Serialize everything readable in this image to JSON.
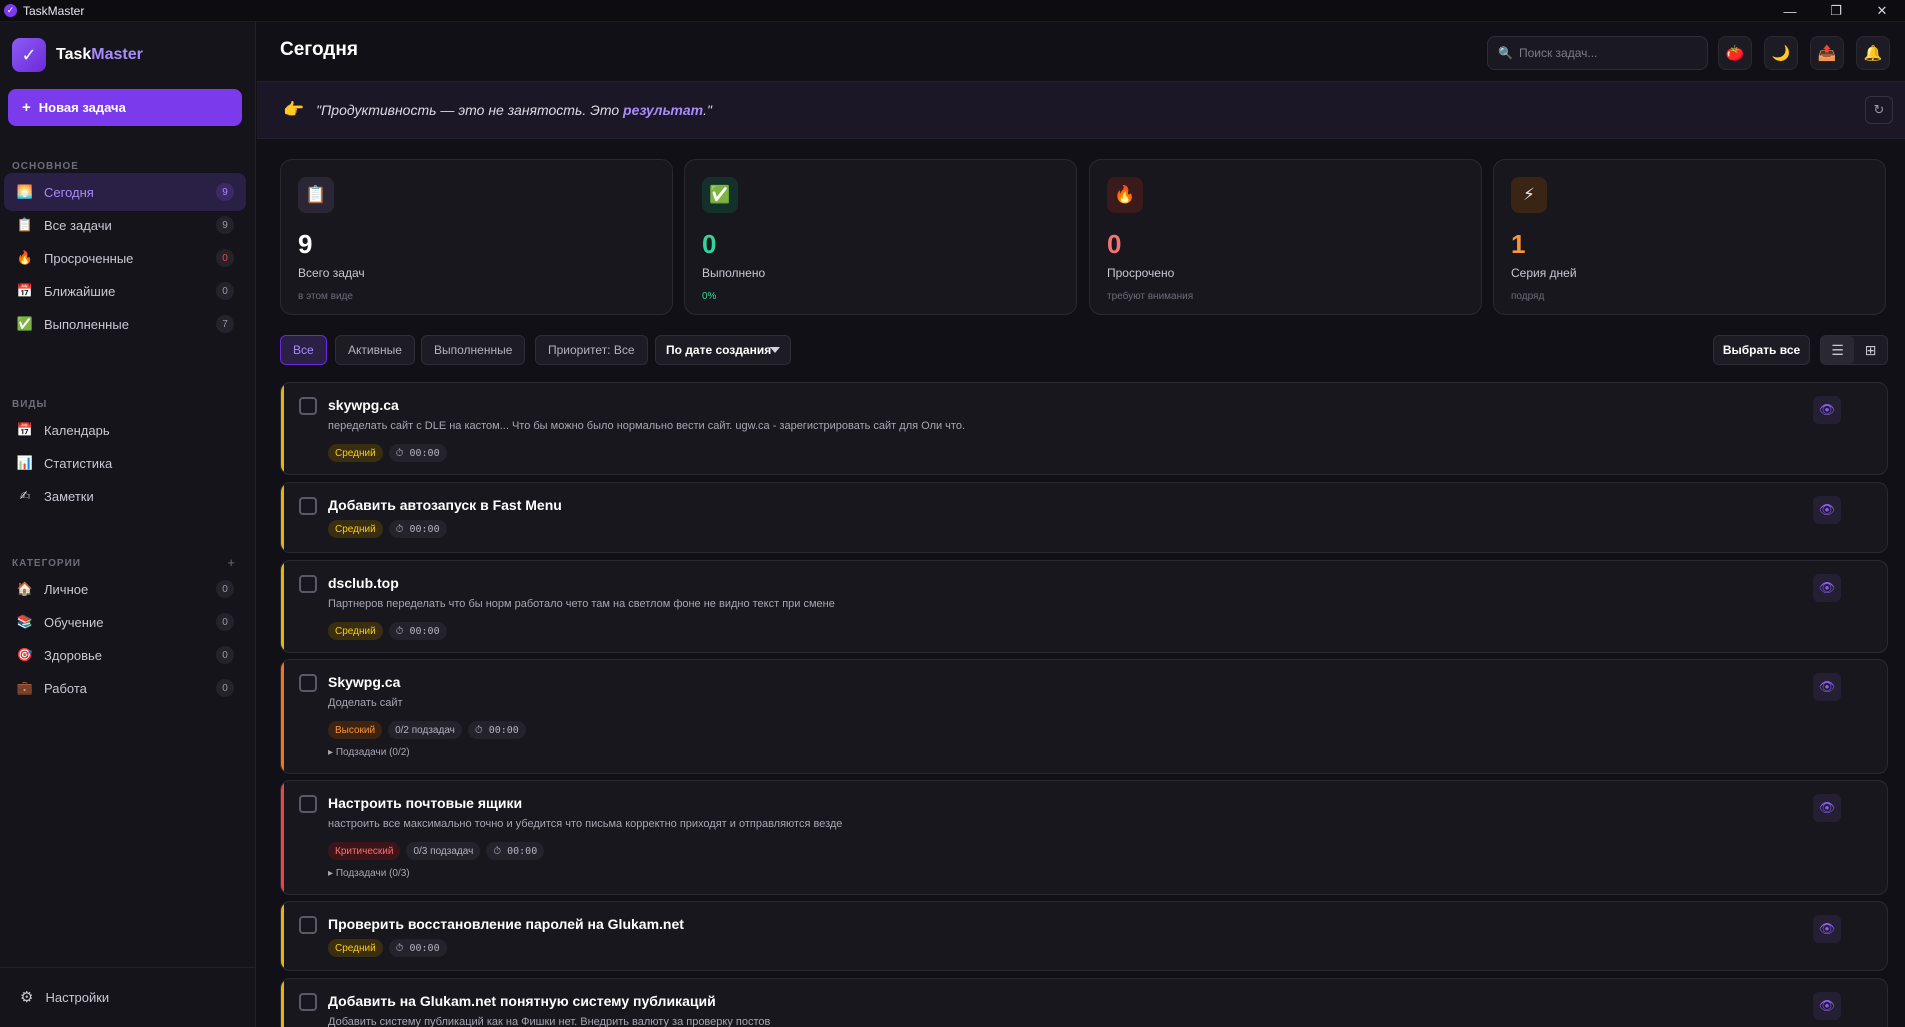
{
  "window": {
    "title": "TaskMaster",
    "minimize": "—",
    "maximize": "❐",
    "close": "✕"
  },
  "sidebar": {
    "brand_prefix": "Task",
    "brand_suffix": "Master",
    "new_task_label": "Новая задача",
    "section_main": "ОСНОВНОЕ",
    "section_views": "ВИДЫ",
    "section_categories": "КАТЕГОРИИ",
    "main_items": [
      {
        "label": "Сегодня",
        "count": "9",
        "icon": "sunrise-icon",
        "glyph": "🌅"
      },
      {
        "label": "Все задачи",
        "count": "9",
        "icon": "clipboard-icon",
        "glyph": "📋"
      },
      {
        "label": "Просроченные",
        "count": "0",
        "icon": "fire-icon",
        "glyph": "🔥"
      },
      {
        "label": "Ближайшие",
        "count": "0",
        "icon": "calendar-icon",
        "glyph": "📅"
      },
      {
        "label": "Выполненные",
        "count": "7",
        "icon": "check-box-icon",
        "glyph": "✅"
      }
    ],
    "view_items": [
      {
        "label": "Календарь",
        "icon": "calendar-icon",
        "glyph": "📅"
      },
      {
        "label": "Статистика",
        "icon": "bar-chart-icon",
        "glyph": "📊"
      },
      {
        "label": "Заметки",
        "icon": "writing-hand-icon",
        "glyph": "✍"
      }
    ],
    "category_items": [
      {
        "label": "Личное",
        "count": "0",
        "icon": "house-icon",
        "glyph": "🏠"
      },
      {
        "label": "Обучение",
        "count": "0",
        "icon": "books-icon",
        "glyph": "📚"
      },
      {
        "label": "Здоровье",
        "count": "0",
        "icon": "target-icon",
        "glyph": "🎯"
      },
      {
        "label": "Работа",
        "count": "0",
        "icon": "briefcase-icon",
        "glyph": "💼"
      }
    ],
    "settings_label": "Настройки"
  },
  "header": {
    "title": "Сегодня",
    "search_placeholder": "Поиск задач..."
  },
  "quote": {
    "before": "\"Продуктивность — это не занятость. Это ",
    "highlight": "результат",
    "after": ".\""
  },
  "stats": [
    {
      "value": "9",
      "label": "Всего задач",
      "sub": "в этом виде",
      "icon": "clipboard-icon",
      "glyph": "📋",
      "color": "#ffffff",
      "bg": "#2a2635",
      "sub_color": "#6e6c78"
    },
    {
      "value": "0",
      "label": "Выполнено",
      "sub": "0%",
      "icon": "check-box-icon",
      "glyph": "✅",
      "color": "#34d399",
      "bg": "#14302a",
      "sub_color": "#34d399"
    },
    {
      "value": "0",
      "label": "Просрочено",
      "sub": "требуют внимания",
      "icon": "fire-icon",
      "glyph": "🔥",
      "color": "#f87171",
      "bg": "#3a1a1a",
      "sub_color": "#6e6c78"
    },
    {
      "value": "1",
      "label": "Серия дней",
      "sub": "подряд",
      "icon": "lightning-icon",
      "glyph": "⚡",
      "color": "#fb923c",
      "bg": "#3a2414",
      "sub_color": "#6e6c78"
    }
  ],
  "filters": {
    "all": "Все",
    "active": "Активные",
    "done": "Выполненные",
    "priority": "Приоритет: Все",
    "sort": "По дате создания",
    "select_all": "Выбрать все"
  },
  "tasks": [
    {
      "title": "skywpg.ca",
      "desc": "переделать сайт с DLE на кастом... Что бы можно было нормально вести сайт. ugw.ca - зарегистрировать сайт для Оли что.",
      "priority": "Средний",
      "priority_class": "med",
      "subtasks_badge": "",
      "timer": "00:00",
      "subtasks_toggle": "",
      "accent": "#eab308"
    },
    {
      "title": "Добавить автозапуск в Fast Menu",
      "desc": "",
      "priority": "Средний",
      "priority_class": "med",
      "subtasks_badge": "",
      "timer": "00:00",
      "subtasks_toggle": "",
      "accent": "#eab308"
    },
    {
      "title": "dsclub.top",
      "desc": "Партнеров переделать что бы норм работало чето там на светлом фоне не видно текст при смене",
      "priority": "Средний",
      "priority_class": "med",
      "subtasks_badge": "",
      "timer": "00:00",
      "subtasks_toggle": "",
      "accent": "#eab308"
    },
    {
      "title": "Skywpg.ca",
      "desc": "Доделать сайт",
      "priority": "Высокий",
      "priority_class": "high",
      "subtasks_badge": "0/2 подзадач",
      "timer": "00:00",
      "subtasks_toggle": "Подзадачи (0/2)",
      "accent": "#f97316"
    },
    {
      "title": "Настроить почтовые ящики",
      "desc": "настроить все максимально точно и убедится что письма корректно приходят и отправляются везде",
      "priority": "Критический",
      "priority_class": "crit",
      "subtasks_badge": "0/3 подзадач",
      "timer": "00:00",
      "subtasks_toggle": "Подзадачи (0/3)",
      "accent": "#ef4444"
    },
    {
      "title": "Проверить восстановление паролей на Glukam.net",
      "desc": "",
      "priority": "Средний",
      "priority_class": "med",
      "subtasks_badge": "",
      "timer": "00:00",
      "subtasks_toggle": "",
      "accent": "#eab308"
    },
    {
      "title": "Добавить на Glukam.net понятную систему публикаций",
      "desc": "Добавить систему публикаций как на Фишки нет. Внедрить валюту за проверку постов",
      "priority": "",
      "priority_class": "med",
      "subtasks_badge": "",
      "timer": "",
      "subtasks_toggle": "",
      "accent": "#eab308"
    }
  ]
}
